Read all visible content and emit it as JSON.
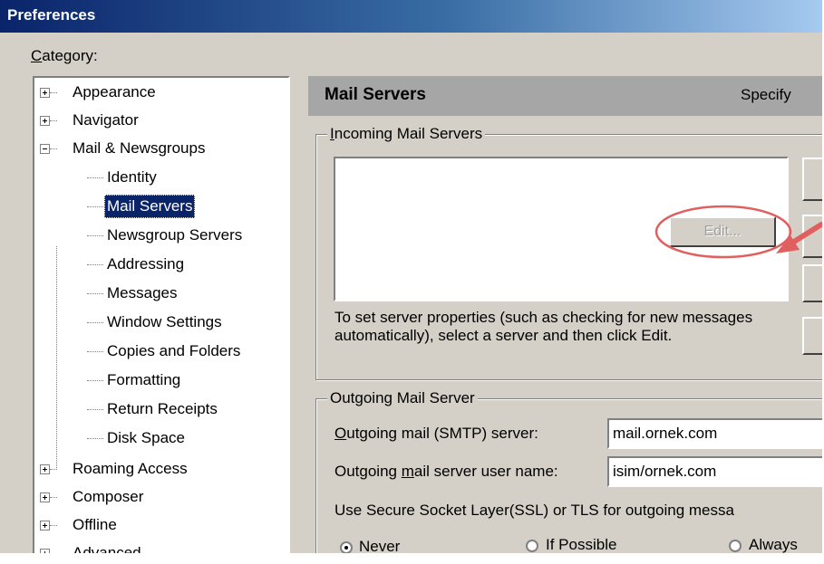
{
  "window": {
    "title": "Preferences"
  },
  "category_label": "Category:",
  "tree": {
    "items": [
      {
        "label": "Appearance",
        "expander": "plus"
      },
      {
        "label": "Navigator",
        "expander": "plus"
      },
      {
        "label": "Mail & Newsgroups",
        "expander": "minus"
      },
      {
        "label": "Identity"
      },
      {
        "label": "Mail Servers",
        "selected": true
      },
      {
        "label": "Newsgroup Servers"
      },
      {
        "label": "Addressing"
      },
      {
        "label": "Messages"
      },
      {
        "label": "Window Settings"
      },
      {
        "label": "Copies and Folders"
      },
      {
        "label": "Formatting"
      },
      {
        "label": "Return Receipts"
      },
      {
        "label": "Disk Space"
      },
      {
        "label": "Roaming Access",
        "expander": "plus"
      },
      {
        "label": "Composer",
        "expander": "plus"
      },
      {
        "label": "Offline",
        "expander": "plus"
      },
      {
        "label": "Advanced",
        "expander": "plus"
      }
    ]
  },
  "panel": {
    "title": "Mail Servers",
    "subtitle": "Specify"
  },
  "incoming": {
    "legend": "Incoming Mail Servers",
    "edit_button": "Edit...",
    "help_text": "To set server properties (such as checking for new messages automatically), select a server and then click Edit."
  },
  "outgoing": {
    "legend": "Outgoing Mail Server",
    "smtp_label": "Outgoing mail (SMTP) server:",
    "smtp_value": "mail.ornek.com",
    "user_label": "Outgoing mail server user name:",
    "user_value": "isim/ornek.com",
    "ssl_label": "Use Secure Socket Layer(SSL) or TLS for outgoing messa",
    "ssl_options": [
      {
        "label": "Never",
        "checked": true
      },
      {
        "label": "If Possible",
        "checked": false
      },
      {
        "label": "Always",
        "checked": false
      }
    ]
  },
  "colors": {
    "title_bar": "#0a246a",
    "dialog_face": "#d4d0c8",
    "selection": "#0a246a",
    "annotation": "#e06060"
  }
}
